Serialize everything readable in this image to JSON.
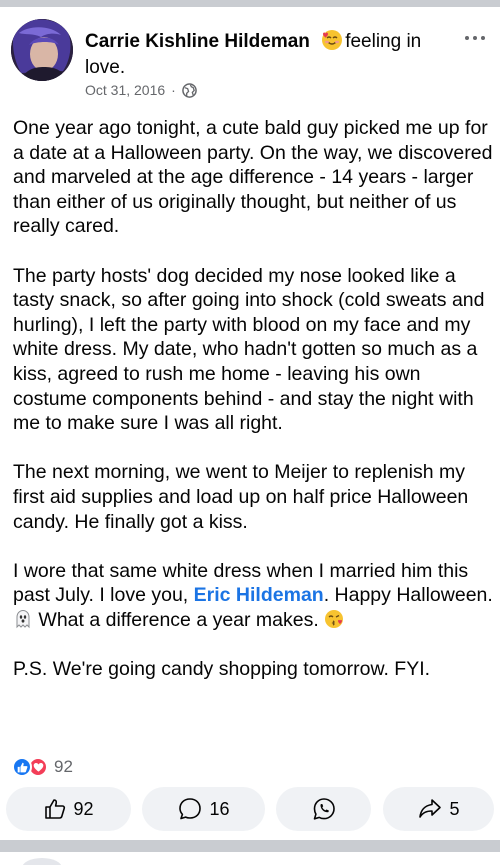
{
  "post": {
    "author": "Carrie Kishline Hildeman",
    "activity_emoji": "smiling-with-hearts-emoji",
    "activity": "feeling in love.",
    "date": "Oct 31, 2016",
    "separator": "·",
    "privacy_icon": "globe-icon",
    "body": {
      "p1": "One year ago tonight, a cute bald guy picked me up for a date at a Halloween party. On the way, we discovered and marveled at the age difference - 14 years - larger than either of us originally thought, but neither of us really cared.",
      "p2": "The party hosts' dog decided my nose looked like a tasty snack, so after going into shock (cold sweats and hurling), I left the party with blood on my face and my white dress. My date, who hadn't gotten so much as a kiss, agreed to rush me home - leaving his own costume components behind - and stay the night with me to make sure I was all right.",
      "p3": "The next morning, we went to Meijer to replenish my first aid supplies and load up on half price Halloween candy. He finally got a kiss.",
      "p4_before_mention": "I wore that same white dress when I married him this past July. I love you, ",
      "p4_mention": "Eric Hildeman",
      "p4_after_mention": ". Happy Halloween. ",
      "p4_after_ghost": " What a difference a year makes. ",
      "p5": "P.S. We're going candy shopping tomorrow. FYI."
    }
  },
  "reactions": {
    "icons": [
      "like-icon",
      "love-icon"
    ],
    "count": "92"
  },
  "actions": {
    "like_count": "92",
    "comment_count": "16",
    "whatsapp_icon": "whatsapp-icon",
    "share_count": "5"
  },
  "colors": {
    "mention": "#1b74e4",
    "like": "#1877f2",
    "love": "#f33e58",
    "secondary_text": "#65676b",
    "button_bg": "#f0f2f5",
    "divider": "#c9ccd1"
  }
}
